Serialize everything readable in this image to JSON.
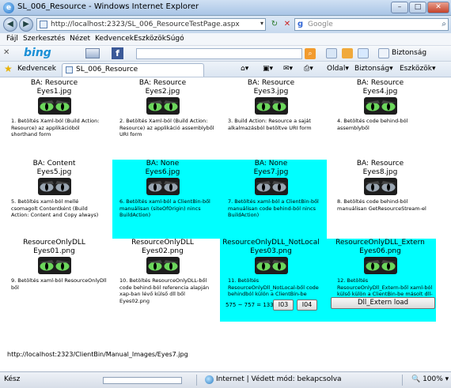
{
  "window": {
    "title": "SL_006_Resource - Windows Internet Explorer"
  },
  "address": {
    "url": "http://localhost:2323/SL_006_ResourceTestPage.aspx",
    "search_placeholder": "Google"
  },
  "menu": [
    "Fájl",
    "Szerkesztés",
    "Nézet",
    "Kedvencek",
    "Eszközök",
    "Súgó"
  ],
  "bing": {
    "logo": "bing"
  },
  "favorites": {
    "label": "Kedvencek",
    "tab_title": "SL_006_Resource"
  },
  "commands": {
    "page": "Oldal",
    "safety": "Biztonság",
    "tools": "Eszközök"
  },
  "cells": [
    {
      "ba": "BA: Resource",
      "file": "Eyes1.jpg",
      "desc": "1. Betöltés Xaml-ból (Build Action: Resource) az applikációból shorthand form",
      "highlight": false,
      "eye_color": "#6bd65b"
    },
    {
      "ba": "BA: Resource",
      "file": "Eyes2.jpg",
      "desc": "2. Betöltés Xaml-ból (Build Action: Resource) az applikáció assemblyből URI form",
      "highlight": false,
      "eye_color": "#6bd65b"
    },
    {
      "ba": "BA: Resource",
      "file": "Eyes3.jpg",
      "desc": "3. Build Action: Resource a saját alkalmazásból betöltve URI form",
      "highlight": false,
      "eye_color": "#6bd65b"
    },
    {
      "ba": "BA: Resource",
      "file": "Eyes4.jpg",
      "desc": "4. Betöltés code behind-ból assemblyből",
      "highlight": false,
      "eye_color": "#6bd65b"
    },
    {
      "ba": "BA: Content",
      "file": "Eyes5.jpg",
      "desc": "5. Betöltés xaml-ból mellé csomagolt Contentként (Build Action: Content and Copy always)",
      "highlight": false,
      "eye_color": "#9aa6b2"
    },
    {
      "ba": "BA: None",
      "file": "Eyes6.jpg",
      "desc": "6. Betöltés xaml-ból a ClientBin-ből manuálisan (siteOfOrigin) nincs BuildAction)",
      "highlight": true,
      "eye_color": "#9aa6b2"
    },
    {
      "ba": "BA: None",
      "file": "Eyes7.jpg",
      "desc": "7. Betöltés xaml-ból a ClientBin-ből manuálisan code behind-ból nincs BuildAction)",
      "highlight": true,
      "eye_color": "#9aa6b2"
    },
    {
      "ba": "BA: Resource",
      "file": "Eyes8.jpg",
      "desc": "8. Betöltés code behind-ból manuálisan GetResourceStream-el",
      "highlight": false,
      "eye_color": "#9aa6b2"
    },
    {
      "ba": "ResourceOnlyDLL",
      "file": "Eyes01.png",
      "desc": "9. Betöltés xaml-ból ResourceOnlyDll ből",
      "highlight": false,
      "eye_color": "#6bd65b"
    },
    {
      "ba": "ResourceOnlyDLL",
      "file": "Eyes02.png",
      "desc": "10. Betöltés ResourceOnlyDLL-ből code behind-ból referencia alapján xap-ban lévő külső dll ből Eyes02.png",
      "highlight": false,
      "eye_color": "#6bd65b"
    },
    {
      "ba": "ResourceOnlyDLL_NotLocal",
      "file": "Eyes03.png",
      "desc": "11. Betöltés ResourceOnlyDll_NotLocal-ből code behindból külön a ClientBin-be",
      "highlight": true,
      "eye_color": "#6bd65b"
    },
    {
      "ba": "ResourceOnlyDLL_Extern",
      "file": "Eyes06.png",
      "desc": "12. Betöltés ResourceOnlyDll_Extern-ből xaml-ból külső külön a ClientBin-be másolt dll-ből",
      "highlight": true,
      "eye_color": "#6bd65b"
    }
  ],
  "calc": {
    "text": "575 ~ 757 = 1332",
    "btn1": "I03",
    "btn2": "I04"
  },
  "dll_button": "Dll_Extern load",
  "bottom_url": "http://localhost:2323/ClientBin/Manual_Images/Eyes7.jpg",
  "status": {
    "text": "Kész",
    "zone": "Internet | Védett mód: bekapcsolva",
    "zoom": "100%"
  }
}
